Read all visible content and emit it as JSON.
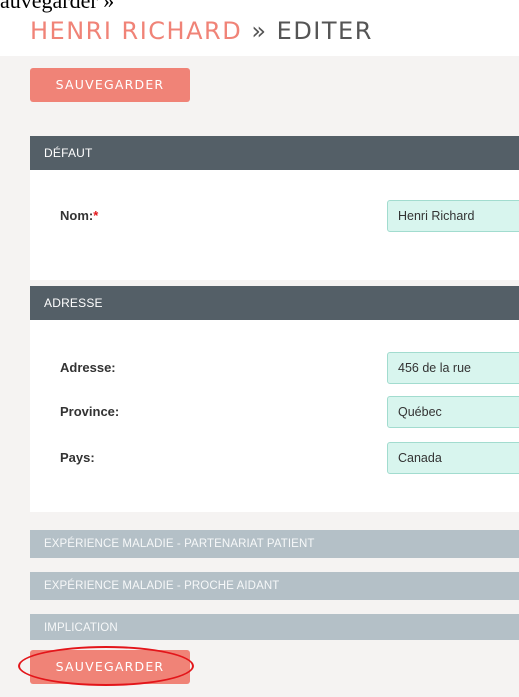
{
  "clip_text": "auvegarder »",
  "header": {
    "record_name": "HENRI RICHARD",
    "separator": "»",
    "action": "EDITER"
  },
  "buttons": {
    "save_top": "SAUVEGARDER",
    "save_bottom": "SAUVEGARDER"
  },
  "panels": {
    "default": {
      "title": "DÉFAUT",
      "fields": [
        {
          "label": "Nom:",
          "required": "*",
          "value": "Henri Richard"
        }
      ]
    },
    "address": {
      "title": "ADRESSE",
      "fields": [
        {
          "label": "Adresse:",
          "value": "456 de la rue"
        },
        {
          "label": "Province:",
          "value": "Québec"
        },
        {
          "label": "Pays:",
          "value": "Canada"
        }
      ]
    }
  },
  "collapsed_sections": [
    "EXPÉRIENCE MALADIE - PARTENARIAT PATIENT",
    "EXPÉRIENCE MALADIE - PROCHE AIDANT",
    "IMPLICATION"
  ],
  "colors": {
    "accent": "#f08377",
    "panel_header": "#545f67",
    "collapsed_header": "#b4c0c7",
    "input_bg": "#d8f5ee",
    "highlight": "#e3151a"
  }
}
